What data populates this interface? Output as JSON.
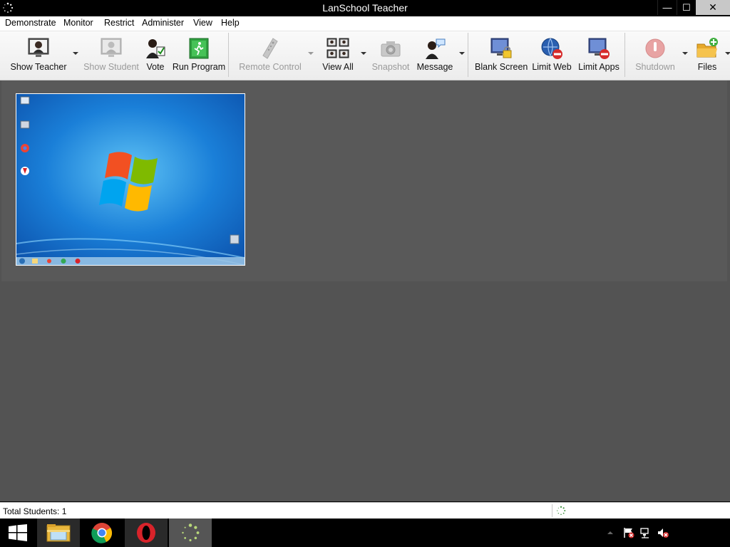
{
  "window": {
    "title": "LanSchool Teacher",
    "minimize": "—",
    "maximize": "☐",
    "close": "✕"
  },
  "menu": [
    "Demonstrate",
    "Monitor",
    "Restrict",
    "Administer",
    "View",
    "Help"
  ],
  "toolbar": {
    "show_teacher": "Show Teacher",
    "show_student": "Show Student",
    "vote": "Vote",
    "run_program": "Run Program",
    "remote_control": "Remote Control",
    "view_all": "View All",
    "snapshot": "Snapshot",
    "message": "Message",
    "blank_screen": "Blank Screen",
    "limit_web": "Limit Web",
    "limit_apps": "Limit Apps",
    "shutdown": "Shutdown",
    "files": "Files"
  },
  "status": {
    "total_students": "Total Students: 1"
  },
  "colors": {
    "main_bg": "#535353",
    "titlebar": "#000000",
    "desktop_blue": "#1a7fd8"
  }
}
